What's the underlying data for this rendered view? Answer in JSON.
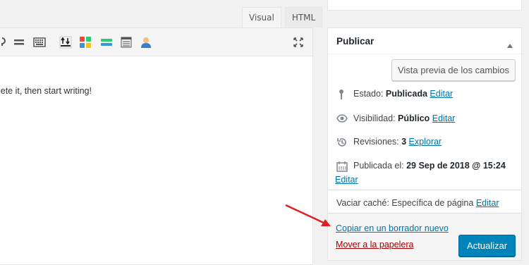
{
  "editor": {
    "tabs": {
      "visual": "Visual",
      "html": "HTML"
    },
    "content_text": "Delete it, then start writing!",
    "toolbar_icons": [
      "more-tag-icon",
      "toolbar-toggle-icon",
      "keyboard-icon",
      "insert-icon",
      "color-blocks-icon",
      "divider-icon",
      "table-icon",
      "user-icon",
      "fullscreen-icon"
    ]
  },
  "publish": {
    "title": "Publicar",
    "preview_button": "Vista previa de los cambios",
    "status": {
      "label": "Estado:",
      "value": "Publicada",
      "action": "Editar"
    },
    "visibility": {
      "label": "Visibilidad:",
      "value": "Público",
      "action": "Editar"
    },
    "revisions": {
      "label": "Revisiones:",
      "value": "3",
      "action": "Explorar"
    },
    "published": {
      "label": "Publicada el:",
      "value": "29 Sep de 2018 @ 15:24",
      "action": "Editar"
    },
    "cache": {
      "label": "Vaciar caché: Específica de página",
      "action": "Editar"
    },
    "copy_link": "Copiar en un borrador nuevo",
    "trash_link": "Mover a la papelera",
    "update_button": "Actualizar"
  },
  "colors": {
    "primary": "#0085ba",
    "link": "#0073aa",
    "delete_link": "#a00",
    "arrow": "#e02020"
  }
}
